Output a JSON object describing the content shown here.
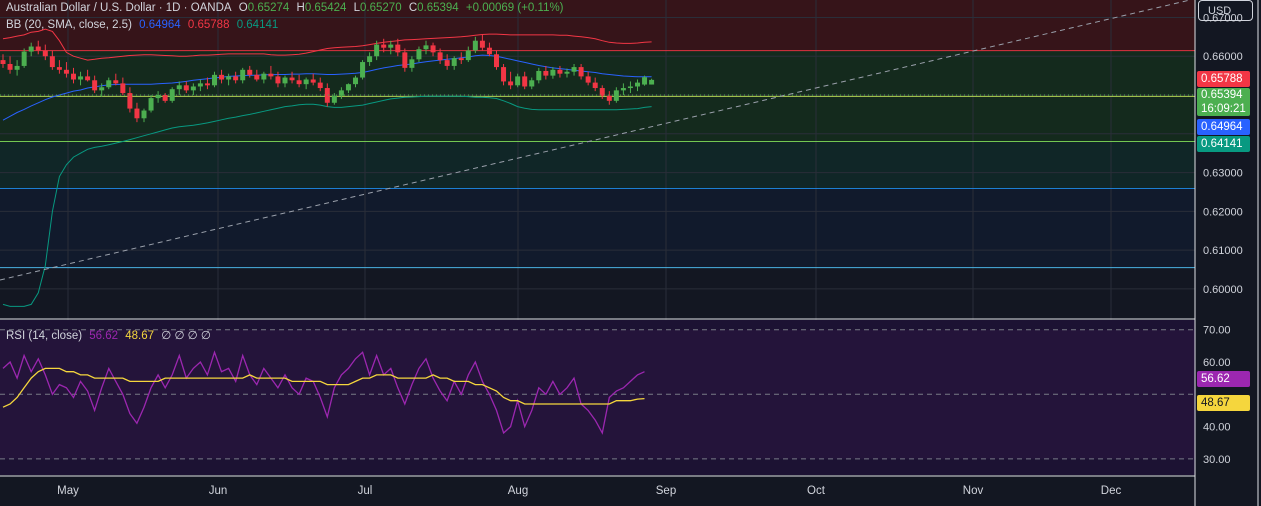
{
  "header": {
    "symbol_title": "Australian Dollar / U.S. Dollar · 1D · OANDA",
    "open_label": "O",
    "open": "0.65274",
    "high_label": "H",
    "high": "0.65424",
    "low_label": "L",
    "low": "0.65270",
    "close_label": "C",
    "close": "0.65394",
    "change": "+0.00069 (+0.11%)"
  },
  "bb_legend": {
    "label": "BB (20, SMA, close, 2.5)",
    "basis": "0.64964",
    "upper": "0.65788",
    "lower": "0.64141"
  },
  "rsi_legend": {
    "label": "RSI (14, close)",
    "rsi": "56.62",
    "ma": "48.67",
    "extra": "∅ ∅ ∅ ∅"
  },
  "currency_button": "USD",
  "price_axis": {
    "labels": [
      "0.67000",
      "0.66000",
      "0.63000",
      "0.62000",
      "0.61000",
      "0.60000"
    ]
  },
  "rsi_axis": {
    "labels": [
      "70.00",
      "60.00",
      "40.00",
      "30.00"
    ]
  },
  "time_axis": {
    "labels": [
      "May",
      "Jun",
      "Jul",
      "Aug",
      "Sep",
      "Oct",
      "Nov",
      "Dec"
    ]
  },
  "price_tags": {
    "upper": "0.65788",
    "last": "0.65394",
    "countdown": "16:09:21",
    "basis": "0.64964",
    "lower": "0.64141",
    "rsi": "56.62",
    "rsi_ma": "48.67"
  },
  "colors": {
    "background": "#131722",
    "bull": "#4caf50",
    "bear": "#f23645",
    "bb_upper": "#f23645",
    "bb_basis": "#2962ff",
    "bb_lower": "#089981",
    "rsi_line": "#9c27b0",
    "rsi_ma": "#f5d63d",
    "zone_red": "#3b1418",
    "zone_green": "#15321c",
    "zone_teal": "#102c2a",
    "zone_blue": "#111c30"
  },
  "chart_data": {
    "type": "candlestick",
    "price_range": [
      0.5925,
      0.6745
    ],
    "rsi_range": [
      25,
      73
    ],
    "horizontal_levels": [
      0.66145,
      0.64965,
      0.638,
      0.6259,
      0.6055
    ],
    "bars": [
      {
        "o": 0.659,
        "h": 0.6605,
        "l": 0.657,
        "c": 0.658
      },
      {
        "o": 0.658,
        "h": 0.66,
        "l": 0.6555,
        "c": 0.6565
      },
      {
        "o": 0.6565,
        "h": 0.659,
        "l": 0.655,
        "c": 0.6575
      },
      {
        "o": 0.6575,
        "h": 0.662,
        "l": 0.657,
        "c": 0.6612
      },
      {
        "o": 0.6612,
        "h": 0.6635,
        "l": 0.66,
        "c": 0.6625
      },
      {
        "o": 0.6625,
        "h": 0.664,
        "l": 0.6605,
        "c": 0.6615
      },
      {
        "o": 0.6615,
        "h": 0.663,
        "l": 0.659,
        "c": 0.66
      },
      {
        "o": 0.66,
        "h": 0.6615,
        "l": 0.6565,
        "c": 0.6572
      },
      {
        "o": 0.6572,
        "h": 0.659,
        "l": 0.6555,
        "c": 0.6565
      },
      {
        "o": 0.6565,
        "h": 0.6585,
        "l": 0.6545,
        "c": 0.6555
      },
      {
        "o": 0.6555,
        "h": 0.657,
        "l": 0.653,
        "c": 0.654
      },
      {
        "o": 0.654,
        "h": 0.656,
        "l": 0.6525,
        "c": 0.6548
      },
      {
        "o": 0.6548,
        "h": 0.6565,
        "l": 0.6535,
        "c": 0.6538
      },
      {
        "o": 0.6538,
        "h": 0.655,
        "l": 0.6505,
        "c": 0.6512
      },
      {
        "o": 0.6512,
        "h": 0.653,
        "l": 0.6495,
        "c": 0.652
      },
      {
        "o": 0.652,
        "h": 0.6545,
        "l": 0.6515,
        "c": 0.6538
      },
      {
        "o": 0.6538,
        "h": 0.6555,
        "l": 0.6525,
        "c": 0.653
      },
      {
        "o": 0.653,
        "h": 0.6545,
        "l": 0.65,
        "c": 0.6505
      },
      {
        "o": 0.6505,
        "h": 0.652,
        "l": 0.6455,
        "c": 0.6465
      },
      {
        "o": 0.6465,
        "h": 0.648,
        "l": 0.643,
        "c": 0.644
      },
      {
        "o": 0.644,
        "h": 0.6465,
        "l": 0.643,
        "c": 0.646
      },
      {
        "o": 0.646,
        "h": 0.65,
        "l": 0.6455,
        "c": 0.6492
      },
      {
        "o": 0.6492,
        "h": 0.651,
        "l": 0.648,
        "c": 0.65
      },
      {
        "o": 0.65,
        "h": 0.6505,
        "l": 0.648,
        "c": 0.6485
      },
      {
        "o": 0.6485,
        "h": 0.652,
        "l": 0.648,
        "c": 0.6515
      },
      {
        "o": 0.6515,
        "h": 0.6535,
        "l": 0.65,
        "c": 0.6525
      },
      {
        "o": 0.6525,
        "h": 0.6535,
        "l": 0.6505,
        "c": 0.6512
      },
      {
        "o": 0.6512,
        "h": 0.653,
        "l": 0.65,
        "c": 0.6522
      },
      {
        "o": 0.6522,
        "h": 0.654,
        "l": 0.651,
        "c": 0.653
      },
      {
        "o": 0.653,
        "h": 0.6545,
        "l": 0.6515,
        "c": 0.6525
      },
      {
        "o": 0.6525,
        "h": 0.656,
        "l": 0.652,
        "c": 0.6552
      },
      {
        "o": 0.6552,
        "h": 0.6565,
        "l": 0.653,
        "c": 0.654
      },
      {
        "o": 0.654,
        "h": 0.6555,
        "l": 0.6525,
        "c": 0.6548
      },
      {
        "o": 0.6548,
        "h": 0.656,
        "l": 0.653,
        "c": 0.6538
      },
      {
        "o": 0.6538,
        "h": 0.657,
        "l": 0.653,
        "c": 0.6565
      },
      {
        "o": 0.6565,
        "h": 0.6575,
        "l": 0.6545,
        "c": 0.6552
      },
      {
        "o": 0.6552,
        "h": 0.6565,
        "l": 0.6535,
        "c": 0.654
      },
      {
        "o": 0.654,
        "h": 0.656,
        "l": 0.653,
        "c": 0.6555
      },
      {
        "o": 0.6555,
        "h": 0.6575,
        "l": 0.654,
        "c": 0.6548
      },
      {
        "o": 0.6548,
        "h": 0.656,
        "l": 0.652,
        "c": 0.653
      },
      {
        "o": 0.653,
        "h": 0.655,
        "l": 0.652,
        "c": 0.6545
      },
      {
        "o": 0.6545,
        "h": 0.656,
        "l": 0.653,
        "c": 0.6538
      },
      {
        "o": 0.6538,
        "h": 0.6552,
        "l": 0.652,
        "c": 0.6528
      },
      {
        "o": 0.6528,
        "h": 0.6545,
        "l": 0.6515,
        "c": 0.654
      },
      {
        "o": 0.654,
        "h": 0.6555,
        "l": 0.6525,
        "c": 0.6532
      },
      {
        "o": 0.6532,
        "h": 0.6545,
        "l": 0.651,
        "c": 0.6518
      },
      {
        "o": 0.6518,
        "h": 0.653,
        "l": 0.647,
        "c": 0.648
      },
      {
        "o": 0.648,
        "h": 0.6505,
        "l": 0.6475,
        "c": 0.6498
      },
      {
        "o": 0.6498,
        "h": 0.652,
        "l": 0.649,
        "c": 0.6512
      },
      {
        "o": 0.6512,
        "h": 0.653,
        "l": 0.6505,
        "c": 0.6528
      },
      {
        "o": 0.6528,
        "h": 0.655,
        "l": 0.652,
        "c": 0.6545
      },
      {
        "o": 0.6545,
        "h": 0.659,
        "l": 0.654,
        "c": 0.6585
      },
      {
        "o": 0.6585,
        "h": 0.661,
        "l": 0.6575,
        "c": 0.66
      },
      {
        "o": 0.66,
        "h": 0.664,
        "l": 0.659,
        "c": 0.663
      },
      {
        "o": 0.663,
        "h": 0.6645,
        "l": 0.661,
        "c": 0.6622
      },
      {
        "o": 0.6622,
        "h": 0.664,
        "l": 0.6605,
        "c": 0.663
      },
      {
        "o": 0.663,
        "h": 0.6645,
        "l": 0.66,
        "c": 0.661
      },
      {
        "o": 0.661,
        "h": 0.662,
        "l": 0.656,
        "c": 0.657
      },
      {
        "o": 0.657,
        "h": 0.66,
        "l": 0.656,
        "c": 0.6592
      },
      {
        "o": 0.6592,
        "h": 0.6625,
        "l": 0.6585,
        "c": 0.6618
      },
      {
        "o": 0.6618,
        "h": 0.664,
        "l": 0.6605,
        "c": 0.6628
      },
      {
        "o": 0.6628,
        "h": 0.6635,
        "l": 0.66,
        "c": 0.661
      },
      {
        "o": 0.661,
        "h": 0.662,
        "l": 0.658,
        "c": 0.659
      },
      {
        "o": 0.659,
        "h": 0.6605,
        "l": 0.6565,
        "c": 0.6575
      },
      {
        "o": 0.6575,
        "h": 0.66,
        "l": 0.6565,
        "c": 0.6595
      },
      {
        "o": 0.6595,
        "h": 0.661,
        "l": 0.658,
        "c": 0.659
      },
      {
        "o": 0.659,
        "h": 0.6625,
        "l": 0.6585,
        "c": 0.6615
      },
      {
        "o": 0.6615,
        "h": 0.665,
        "l": 0.6608,
        "c": 0.664
      },
      {
        "o": 0.664,
        "h": 0.6655,
        "l": 0.6615,
        "c": 0.6622
      },
      {
        "o": 0.6622,
        "h": 0.6635,
        "l": 0.66,
        "c": 0.6605
      },
      {
        "o": 0.6605,
        "h": 0.6615,
        "l": 0.6565,
        "c": 0.6572
      },
      {
        "o": 0.6572,
        "h": 0.658,
        "l": 0.6525,
        "c": 0.6535
      },
      {
        "o": 0.6535,
        "h": 0.656,
        "l": 0.6515,
        "c": 0.6525
      },
      {
        "o": 0.6525,
        "h": 0.6555,
        "l": 0.652,
        "c": 0.6548
      },
      {
        "o": 0.6548,
        "h": 0.656,
        "l": 0.6515,
        "c": 0.6522
      },
      {
        "o": 0.6522,
        "h": 0.6545,
        "l": 0.6515,
        "c": 0.6538
      },
      {
        "o": 0.6538,
        "h": 0.657,
        "l": 0.653,
        "c": 0.6562
      },
      {
        "o": 0.6562,
        "h": 0.6575,
        "l": 0.654,
        "c": 0.655
      },
      {
        "o": 0.655,
        "h": 0.6572,
        "l": 0.6542,
        "c": 0.6565
      },
      {
        "o": 0.6565,
        "h": 0.6575,
        "l": 0.6545,
        "c": 0.6555
      },
      {
        "o": 0.6555,
        "h": 0.6568,
        "l": 0.6545,
        "c": 0.656
      },
      {
        "o": 0.656,
        "h": 0.658,
        "l": 0.655,
        "c": 0.6572
      },
      {
        "o": 0.6572,
        "h": 0.658,
        "l": 0.654,
        "c": 0.6548
      },
      {
        "o": 0.6548,
        "h": 0.656,
        "l": 0.6525,
        "c": 0.6532
      },
      {
        "o": 0.6532,
        "h": 0.6545,
        "l": 0.651,
        "c": 0.6518
      },
      {
        "o": 0.6518,
        "h": 0.6525,
        "l": 0.649,
        "c": 0.6498
      },
      {
        "o": 0.6498,
        "h": 0.651,
        "l": 0.6475,
        "c": 0.6485
      },
      {
        "o": 0.6485,
        "h": 0.652,
        "l": 0.648,
        "c": 0.6512
      },
      {
        "o": 0.6512,
        "h": 0.653,
        "l": 0.65,
        "c": 0.6518
      },
      {
        "o": 0.6518,
        "h": 0.6535,
        "l": 0.6505,
        "c": 0.6522
      },
      {
        "o": 0.6522,
        "h": 0.654,
        "l": 0.651,
        "c": 0.6532
      },
      {
        "o": 0.6527,
        "h": 0.655,
        "l": 0.6524,
        "c": 0.6546
      },
      {
        "o": 0.6527,
        "h": 0.6542,
        "l": 0.6527,
        "c": 0.6539
      }
    ],
    "bb_upper": [
      0.6645,
      0.6648,
      0.6652,
      0.6655,
      0.6662,
      0.6664,
      0.667,
      0.6664,
      0.664,
      0.661,
      0.66,
      0.6595,
      0.659,
      0.6592,
      0.6595,
      0.6596,
      0.6598,
      0.66,
      0.6602,
      0.6603,
      0.6604,
      0.6604,
      0.6603,
      0.6602,
      0.6601,
      0.66,
      0.66,
      0.6601,
      0.6603,
      0.6603,
      0.6604,
      0.6605,
      0.6606,
      0.6606,
      0.6606,
      0.6606,
      0.6606,
      0.6606,
      0.6604,
      0.6603,
      0.6603,
      0.6604,
      0.6605,
      0.6608,
      0.6612,
      0.6616,
      0.662,
      0.6622,
      0.6623,
      0.6624,
      0.6625,
      0.6627,
      0.663,
      0.6633,
      0.6636,
      0.6638,
      0.664,
      0.6642,
      0.6643,
      0.6644,
      0.6645,
      0.6646,
      0.6647,
      0.6648,
      0.6649,
      0.665,
      0.6652,
      0.6654,
      0.6656,
      0.6657,
      0.6657,
      0.6656,
      0.6655,
      0.6655,
      0.6655,
      0.6655,
      0.6655,
      0.6655,
      0.6655,
      0.6654,
      0.6654,
      0.6652,
      0.665,
      0.6648,
      0.6645,
      0.664,
      0.6636,
      0.6634,
      0.6633,
      0.6633,
      0.6634,
      0.6636,
      0.6637
    ],
    "bb_basis": [
      0.6435,
      0.6445,
      0.6455,
      0.6463,
      0.6472,
      0.648,
      0.6488,
      0.6495,
      0.65,
      0.6505,
      0.651,
      0.6513,
      0.6518,
      0.6521,
      0.6524,
      0.6526,
      0.6527,
      0.6528,
      0.6528,
      0.6528,
      0.6528,
      0.6528,
      0.6529,
      0.653,
      0.6531,
      0.6533,
      0.6535,
      0.6538,
      0.654,
      0.6542,
      0.6544,
      0.6546,
      0.6548,
      0.6549,
      0.655,
      0.6551,
      0.6551,
      0.6552,
      0.6552,
      0.6553,
      0.6553,
      0.6554,
      0.6554,
      0.6555,
      0.6555,
      0.6554,
      0.6553,
      0.6553,
      0.6554,
      0.6555,
      0.6556,
      0.6558,
      0.6562,
      0.6566,
      0.657,
      0.6573,
      0.6576,
      0.6578,
      0.658,
      0.6583,
      0.6586,
      0.6588,
      0.659,
      0.6592,
      0.6594,
      0.6596,
      0.6598,
      0.6601,
      0.6603,
      0.6602,
      0.66,
      0.6596,
      0.6592,
      0.6588,
      0.6584,
      0.658,
      0.6576,
      0.6573,
      0.657,
      0.6568,
      0.6566,
      0.6564,
      0.6562,
      0.656,
      0.6558,
      0.6555,
      0.6553,
      0.6551,
      0.6549,
      0.6548,
      0.6547,
      0.6547,
      0.6547
    ],
    "bb_lower": [
      0.596,
      0.5955,
      0.5955,
      0.5955,
      0.596,
      0.599,
      0.606,
      0.62,
      0.629,
      0.632,
      0.634,
      0.635,
      0.636,
      0.6365,
      0.6368,
      0.6372,
      0.6376,
      0.638,
      0.6385,
      0.639,
      0.6395,
      0.64,
      0.6405,
      0.641,
      0.6415,
      0.6418,
      0.642,
      0.6422,
      0.6425,
      0.6428,
      0.6432,
      0.6436,
      0.644,
      0.6443,
      0.6447,
      0.645,
      0.6454,
      0.6458,
      0.6462,
      0.6466,
      0.647,
      0.6472,
      0.6475,
      0.6476,
      0.6476,
      0.6474,
      0.647,
      0.6468,
      0.6468,
      0.647,
      0.6472,
      0.6474,
      0.6478,
      0.6482,
      0.6486,
      0.649,
      0.6492,
      0.6494,
      0.6495,
      0.6496,
      0.6497,
      0.6497,
      0.6497,
      0.6497,
      0.6497,
      0.6497,
      0.6496,
      0.6494,
      0.6494,
      0.6493,
      0.6491,
      0.6485,
      0.6478,
      0.647,
      0.6466,
      0.6463,
      0.6462,
      0.6462,
      0.6462,
      0.6462,
      0.6462,
      0.6462,
      0.6462,
      0.6462,
      0.6462,
      0.6462,
      0.6462,
      0.6462,
      0.6463,
      0.6464,
      0.6465,
      0.6468,
      0.647
    ],
    "rsi": [
      58,
      60,
      55,
      62,
      57,
      61,
      56,
      50,
      53,
      52,
      49,
      54,
      51,
      45,
      52,
      58,
      54,
      50,
      44,
      41,
      46,
      52,
      56,
      52,
      56,
      62,
      55,
      58,
      60,
      56,
      63,
      57,
      58,
      54,
      62,
      56,
      53,
      58,
      55,
      52,
      56,
      52,
      50,
      55,
      54,
      49,
      43,
      52,
      56,
      58,
      61,
      63,
      56,
      62,
      56,
      58,
      52,
      47,
      53,
      58,
      61,
      55,
      51,
      48,
      54,
      50,
      56,
      60,
      54,
      50,
      45,
      38,
      40,
      48,
      40,
      45,
      52,
      50,
      54,
      50,
      52,
      55,
      47,
      45,
      42,
      38,
      49,
      51,
      52,
      54,
      56,
      57
    ],
    "rsi_ma": [
      46,
      47,
      49,
      52,
      55,
      57,
      58,
      58,
      58,
      57,
      57,
      56,
      56,
      55,
      55,
      55,
      55,
      55,
      54,
      54,
      54,
      54,
      54,
      55,
      55,
      55,
      55,
      55,
      55,
      55,
      55,
      55,
      55,
      55,
      55,
      56,
      55,
      55,
      55,
      55,
      55,
      54,
      54,
      54,
      54,
      54,
      53,
      53,
      53,
      53,
      54,
      55,
      55,
      56,
      56,
      56,
      55,
      55,
      55,
      55,
      55,
      56,
      55,
      55,
      54,
      54,
      54,
      53,
      53,
      52,
      51,
      49,
      48,
      48,
      47,
      47,
      47,
      47,
      47,
      47,
      47,
      47,
      47,
      47,
      47,
      47,
      47,
      48,
      48,
      48,
      48.5,
      48.67
    ]
  }
}
